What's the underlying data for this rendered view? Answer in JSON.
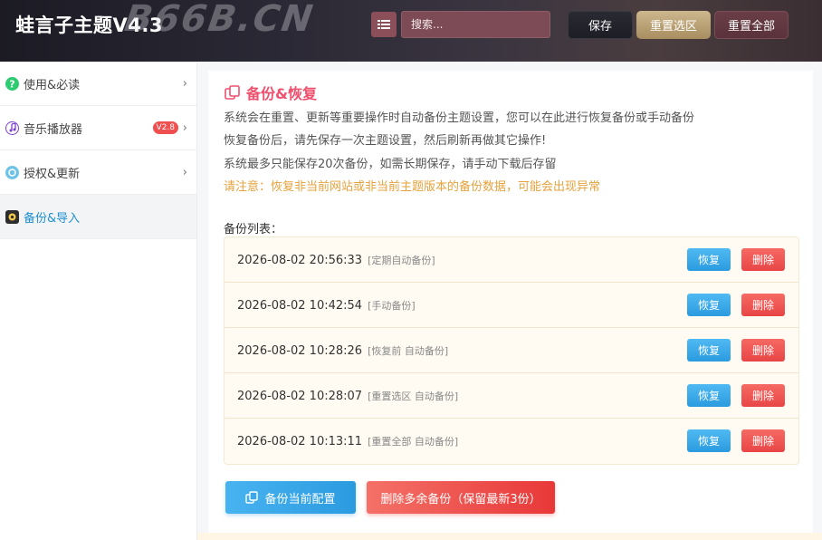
{
  "header": {
    "app_title": "蛙言子主题V4.3",
    "watermark": "B66B.CN",
    "search_placeholder": "搜索...",
    "save_label": "保存",
    "reset_selection_label": "重置选区",
    "reset_all_label": "重置全部"
  },
  "sidebar": {
    "items": [
      {
        "label": "使用&必读",
        "icon": "question-circle-icon",
        "badge": "",
        "active": false
      },
      {
        "label": "音乐播放器",
        "icon": "music-note-icon",
        "badge": "V2.8",
        "active": false
      },
      {
        "label": "授权&更新",
        "icon": "refresh-circle-icon",
        "badge": "",
        "active": false
      },
      {
        "label": "备份&导入",
        "icon": "backup-icon",
        "badge": "",
        "active": true
      }
    ]
  },
  "main": {
    "title": "备份&恢复",
    "desc_lines": [
      "系统会在重置、更新等重要操作时自动备份主题设置，您可以在此进行恢复备份或手动备份",
      "恢复备份后，请先保存一次主题设置，然后刷新再做其它操作!",
      "系统最多只能保存20次备份，如需长期保存，请手动下载后存留"
    ],
    "warning": "请注意：恢复非当前网站或非当前主题版本的备份数据，可能会出现异常",
    "list_label": "备份列表：",
    "backups": [
      {
        "time": "2026-08-02 20:56:33",
        "type": "[定期自动备份]"
      },
      {
        "time": "2026-08-02 10:42:54",
        "type": "[手动备份]"
      },
      {
        "time": "2026-08-02 10:28:26",
        "type": "[恢复前 自动备份]"
      },
      {
        "time": "2026-08-02 10:28:07",
        "type": "[重置选区 自动备份]"
      },
      {
        "time": "2026-08-02 10:13:11",
        "type": "[重置全部 自动备份]"
      }
    ],
    "restore_label": "恢复",
    "delete_label": "删除",
    "backup_now_label": "备份当前配置",
    "clean_label": "删除多余备份（保留最新3份）"
  },
  "colors": {
    "accent_title": "#f0506e",
    "warning": "#e6a23c",
    "restore_button": "#2b9be0",
    "delete_button": "#e84545",
    "active_nav": "#1e8fd1"
  }
}
